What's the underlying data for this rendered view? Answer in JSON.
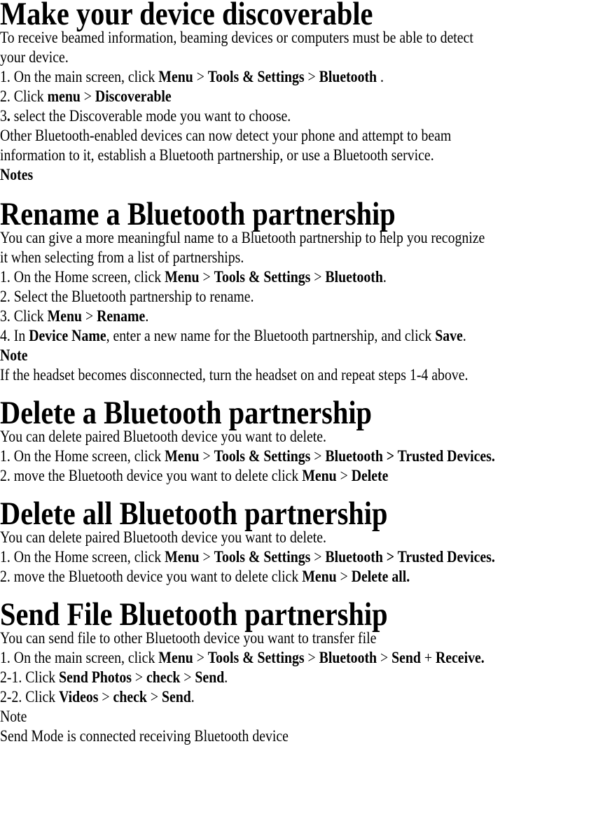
{
  "sections": [
    {
      "title": "Make your device discoverable",
      "lines": [
        [
          {
            "t": "To receive beamed information, beaming devices or computers must be able to detect"
          }
        ],
        [
          {
            "t": "your device."
          }
        ],
        [
          {
            "t": "1. On the main screen, click "
          },
          {
            "t": "Menu",
            "b": true
          },
          {
            "t": " > "
          },
          {
            "t": "Tools & Settings",
            "b": true
          },
          {
            "t": " > "
          },
          {
            "t": "Bluetooth",
            "b": true
          },
          {
            "t": " ."
          }
        ],
        [
          {
            "t": "2. Click "
          },
          {
            "t": "menu",
            "b": true
          },
          {
            "t": " > "
          },
          {
            "t": "Discoverable",
            "b": true
          }
        ],
        [
          {
            "t": "3"
          },
          {
            "t": ".",
            "b": true
          },
          {
            "t": " select the Discoverable mode you want to choose."
          }
        ],
        [
          {
            "t": "Other Bluetooth-enabled devices can now detect your phone and attempt to beam"
          }
        ],
        [
          {
            "t": "information to it, establish a Bluetooth partnership, or use a Bluetooth service."
          }
        ],
        [
          {
            "t": "Notes",
            "b": true
          }
        ]
      ]
    },
    {
      "title": "Rename a Bluetooth partnership",
      "lines": [
        [
          {
            "t": "You can give a more meaningful name to a Bluetooth partnership to help you recognize"
          }
        ],
        [
          {
            "t": "it when selecting from a list of partnerships."
          }
        ],
        [
          {
            "t": "1. On the Home screen, click "
          },
          {
            "t": "Menu",
            "b": true
          },
          {
            "t": " > "
          },
          {
            "t": "Tools & Settings",
            "b": true
          },
          {
            "t": " > "
          },
          {
            "t": "Bluetooth",
            "b": true
          },
          {
            "t": "."
          }
        ],
        [
          {
            "t": "2. Select the Bluetooth partnership to rename."
          }
        ],
        [
          {
            "t": "3. Click "
          },
          {
            "t": "Menu",
            "b": true
          },
          {
            "t": " > "
          },
          {
            "t": "Rename",
            "b": true
          },
          {
            "t": "."
          }
        ],
        [
          {
            "t": "4. In "
          },
          {
            "t": "Device Name",
            "b": true
          },
          {
            "t": ", enter a new name for the Bluetooth partnership, and click "
          },
          {
            "t": "Save",
            "b": true
          },
          {
            "t": "."
          }
        ],
        [
          {
            "t": "Note",
            "b": true
          }
        ],
        [
          {
            "t": "If the headset becomes disconnected, turn the headset on and repeat steps 1-4 above."
          }
        ]
      ]
    },
    {
      "title": "Delete a Bluetooth partnership",
      "lines": [
        [
          {
            "t": "You can delete paired Bluetooth device you want to delete."
          }
        ],
        [
          {
            "t": "1. On the Home screen, click "
          },
          {
            "t": "Menu",
            "b": true
          },
          {
            "t": " > "
          },
          {
            "t": "Tools & Settings",
            "b": true
          },
          {
            "t": " > "
          },
          {
            "t": "Bluetooth > Trusted Devices.",
            "b": true
          }
        ],
        [
          {
            "t": "2. move the Bluetooth device you want to delete click "
          },
          {
            "t": "Menu",
            "b": true
          },
          {
            "t": " > "
          },
          {
            "t": "Delete",
            "b": true
          }
        ]
      ]
    },
    {
      "title": "Delete all Bluetooth partnership",
      "lines": [
        [
          {
            "t": "You can delete paired Bluetooth device you want to delete."
          }
        ],
        [
          {
            "t": "1. On the Home screen, click "
          },
          {
            "t": "Menu",
            "b": true
          },
          {
            "t": " > "
          },
          {
            "t": "Tools & Settings",
            "b": true
          },
          {
            "t": " > "
          },
          {
            "t": "Bluetooth > Trusted Devices.",
            "b": true
          }
        ],
        [
          {
            "t": "2. move the Bluetooth device you want to delete click "
          },
          {
            "t": "Menu",
            "b": true
          },
          {
            "t": " > "
          },
          {
            "t": "Delete all.",
            "b": true
          }
        ]
      ]
    },
    {
      "title": "Send File Bluetooth partnership",
      "lines": [
        [
          {
            "t": "You can send file to other Bluetooth device you want to transfer file"
          }
        ],
        [
          {
            "t": "1. On the main screen, click "
          },
          {
            "t": "Menu",
            "b": true
          },
          {
            "t": " > "
          },
          {
            "t": "Tools & Settings",
            "b": true
          },
          {
            "t": " > "
          },
          {
            "t": "Bluetooth",
            "b": true
          },
          {
            "t": " > "
          },
          {
            "t": "Send",
            "b": true
          },
          {
            "t": " + "
          },
          {
            "t": "Receive.",
            "b": true
          }
        ],
        [
          {
            "t": "2-1. Click "
          },
          {
            "t": "Send Photos",
            "b": true
          },
          {
            "t": " > "
          },
          {
            "t": "check",
            "b": true
          },
          {
            "t": " > "
          },
          {
            "t": "Send",
            "b": true
          },
          {
            "t": "."
          }
        ],
        [
          {
            "t": "2-2. Click "
          },
          {
            "t": "Videos",
            "b": true
          },
          {
            "t": " > "
          },
          {
            "t": "check",
            "b": true
          },
          {
            "t": " > "
          },
          {
            "t": "Send",
            "b": true
          },
          {
            "t": "."
          }
        ],
        [
          {
            "t": "Note"
          }
        ],
        [
          {
            "t": "Send Mode is connected receiving Bluetooth device"
          }
        ]
      ]
    }
  ]
}
